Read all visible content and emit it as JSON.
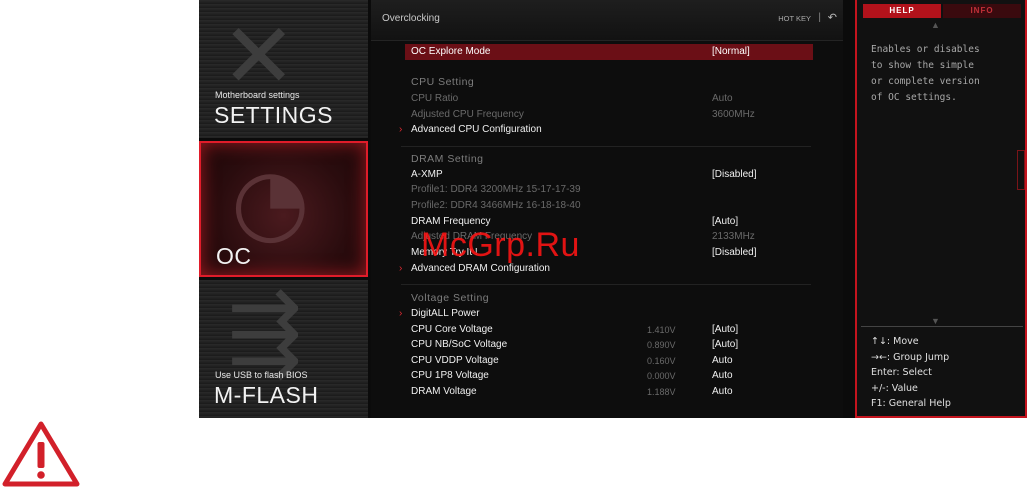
{
  "nav": {
    "settings": {
      "small": "Motherboard settings",
      "big": "SETTINGS"
    },
    "oc": {
      "big": "OC"
    },
    "mflash": {
      "small": "Use USB to flash BIOS",
      "big": "M-FLASH"
    }
  },
  "header": {
    "title": "Overclocking",
    "hotkey": "HOT KEY",
    "separator": "|",
    "back_icon": "back-arrow-icon"
  },
  "rows": [
    {
      "label": "OC Explore Mode",
      "value": "[Normal]",
      "kind": "sel"
    },
    {
      "label": "CPU Setting",
      "kind": "sec"
    },
    {
      "label": "CPU Ratio",
      "value": "Auto",
      "kind": "dim"
    },
    {
      "label": "Adjusted CPU Frequency",
      "value": "3600MHz",
      "kind": "dim"
    },
    {
      "label": "Advanced CPU Configuration",
      "kind": "norm",
      "arrow": true
    },
    {
      "label": "DRAM Setting",
      "kind": "sec"
    },
    {
      "label": "A-XMP",
      "value": "[Disabled]",
      "kind": "norm"
    },
    {
      "label": "Profile1: DDR4 3200MHz 15-17-17-39",
      "kind": "dim"
    },
    {
      "label": "Profile2: DDR4 3466MHz 16-18-18-40",
      "kind": "dim"
    },
    {
      "label": "DRAM Frequency",
      "value": "[Auto]",
      "kind": "norm"
    },
    {
      "label": "Adjusted DRAM Frequency",
      "value": "2133MHz",
      "kind": "dim"
    },
    {
      "label": "Memory Try It !",
      "value": "[Disabled]",
      "kind": "norm"
    },
    {
      "label": "Advanced DRAM Configuration",
      "kind": "norm",
      "arrow": true
    },
    {
      "label": "Voltage Setting",
      "kind": "sec"
    },
    {
      "label": "DigitALL Power",
      "kind": "norm",
      "arrow": true
    },
    {
      "label": "CPU Core Voltage",
      "mid": "1.410V",
      "value": "[Auto]",
      "kind": "norm"
    },
    {
      "label": "CPU NB/SoC Voltage",
      "mid": "0.890V",
      "value": "[Auto]",
      "kind": "norm"
    },
    {
      "label": "CPU VDDP Voltage",
      "mid": "0.160V",
      "value": "Auto",
      "kind": "norm"
    },
    {
      "label": "CPU 1P8 Voltage",
      "mid": "0.000V",
      "value": "Auto",
      "kind": "norm"
    },
    {
      "label": "DRAM Voltage",
      "mid": "1.188V",
      "value": "Auto",
      "kind": "norm"
    }
  ],
  "help": {
    "tab_help": "HELP",
    "tab_info": "INFO",
    "text": "Enables or disables\nto show the simple\nor complete version\nof OC settings.",
    "keys": [
      "↑↓: Move",
      "→←: Group Jump",
      "Enter: Select",
      "+/-: Value",
      "F1: General Help"
    ]
  },
  "watermark": "McGrp.Ru",
  "colors": {
    "accent": "#e01c2a",
    "selected_row": "#6b0f16"
  }
}
